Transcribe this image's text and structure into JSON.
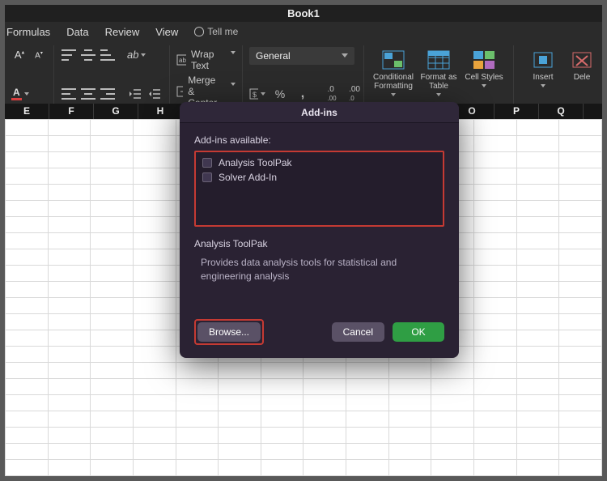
{
  "window": {
    "title": "Book1"
  },
  "ribbon": {
    "tabs": [
      "Formulas",
      "Data",
      "Review",
      "View"
    ],
    "tellme": "Tell me",
    "wrap_label": "Wrap Text",
    "merge_label": "Merge & Center",
    "number_format": "General",
    "style_buttons": {
      "cond_fmt": "Conditional Formatting",
      "fmt_table": "Format as Table",
      "cell_styles": "Cell Styles",
      "insert": "Insert",
      "delete": "Dele"
    }
  },
  "columns": [
    "E",
    "F",
    "G",
    "H",
    "",
    "",
    "",
    "",
    "",
    "",
    "O",
    "P",
    "Q"
  ],
  "dialog": {
    "title": "Add-ins",
    "available_label": "Add-ins available:",
    "items": [
      {
        "label": "Analysis ToolPak",
        "checked": false
      },
      {
        "label": "Solver Add-In",
        "checked": false
      }
    ],
    "section_heading": "Analysis ToolPak",
    "description": "Provides data analysis tools for statistical and engineering analysis",
    "browse_label": "Browse...",
    "cancel_label": "Cancel",
    "ok_label": "OK"
  }
}
